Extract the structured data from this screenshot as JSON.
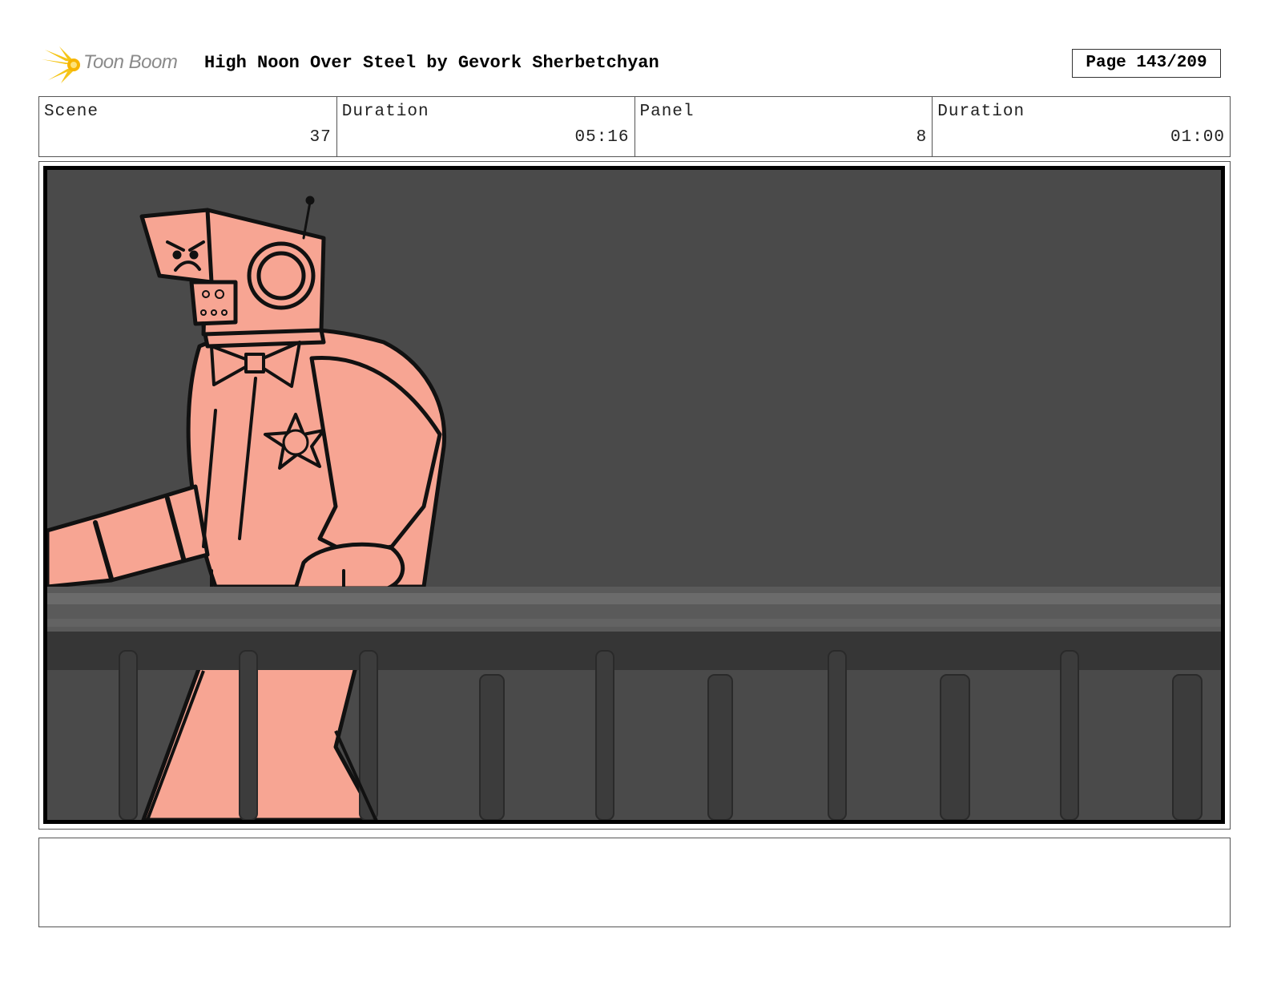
{
  "header": {
    "logo_text": "Toon Boom",
    "title": "High Noon Over Steel by Gevork Sherbetchyan",
    "page": "Page 143/209"
  },
  "info": {
    "scene_label": "Scene",
    "scene_value": "37",
    "scene_duration_label": "Duration",
    "scene_duration_value": "05:16",
    "panel_label": "Panel",
    "panel_value": "8",
    "panel_duration_label": "Duration",
    "panel_duration_value": "01:00"
  },
  "colors": {
    "character_fill": "#f7a593",
    "background": "#4a4a4a",
    "logo_accent": "#f5c518"
  },
  "notes": {
    "text": ""
  }
}
